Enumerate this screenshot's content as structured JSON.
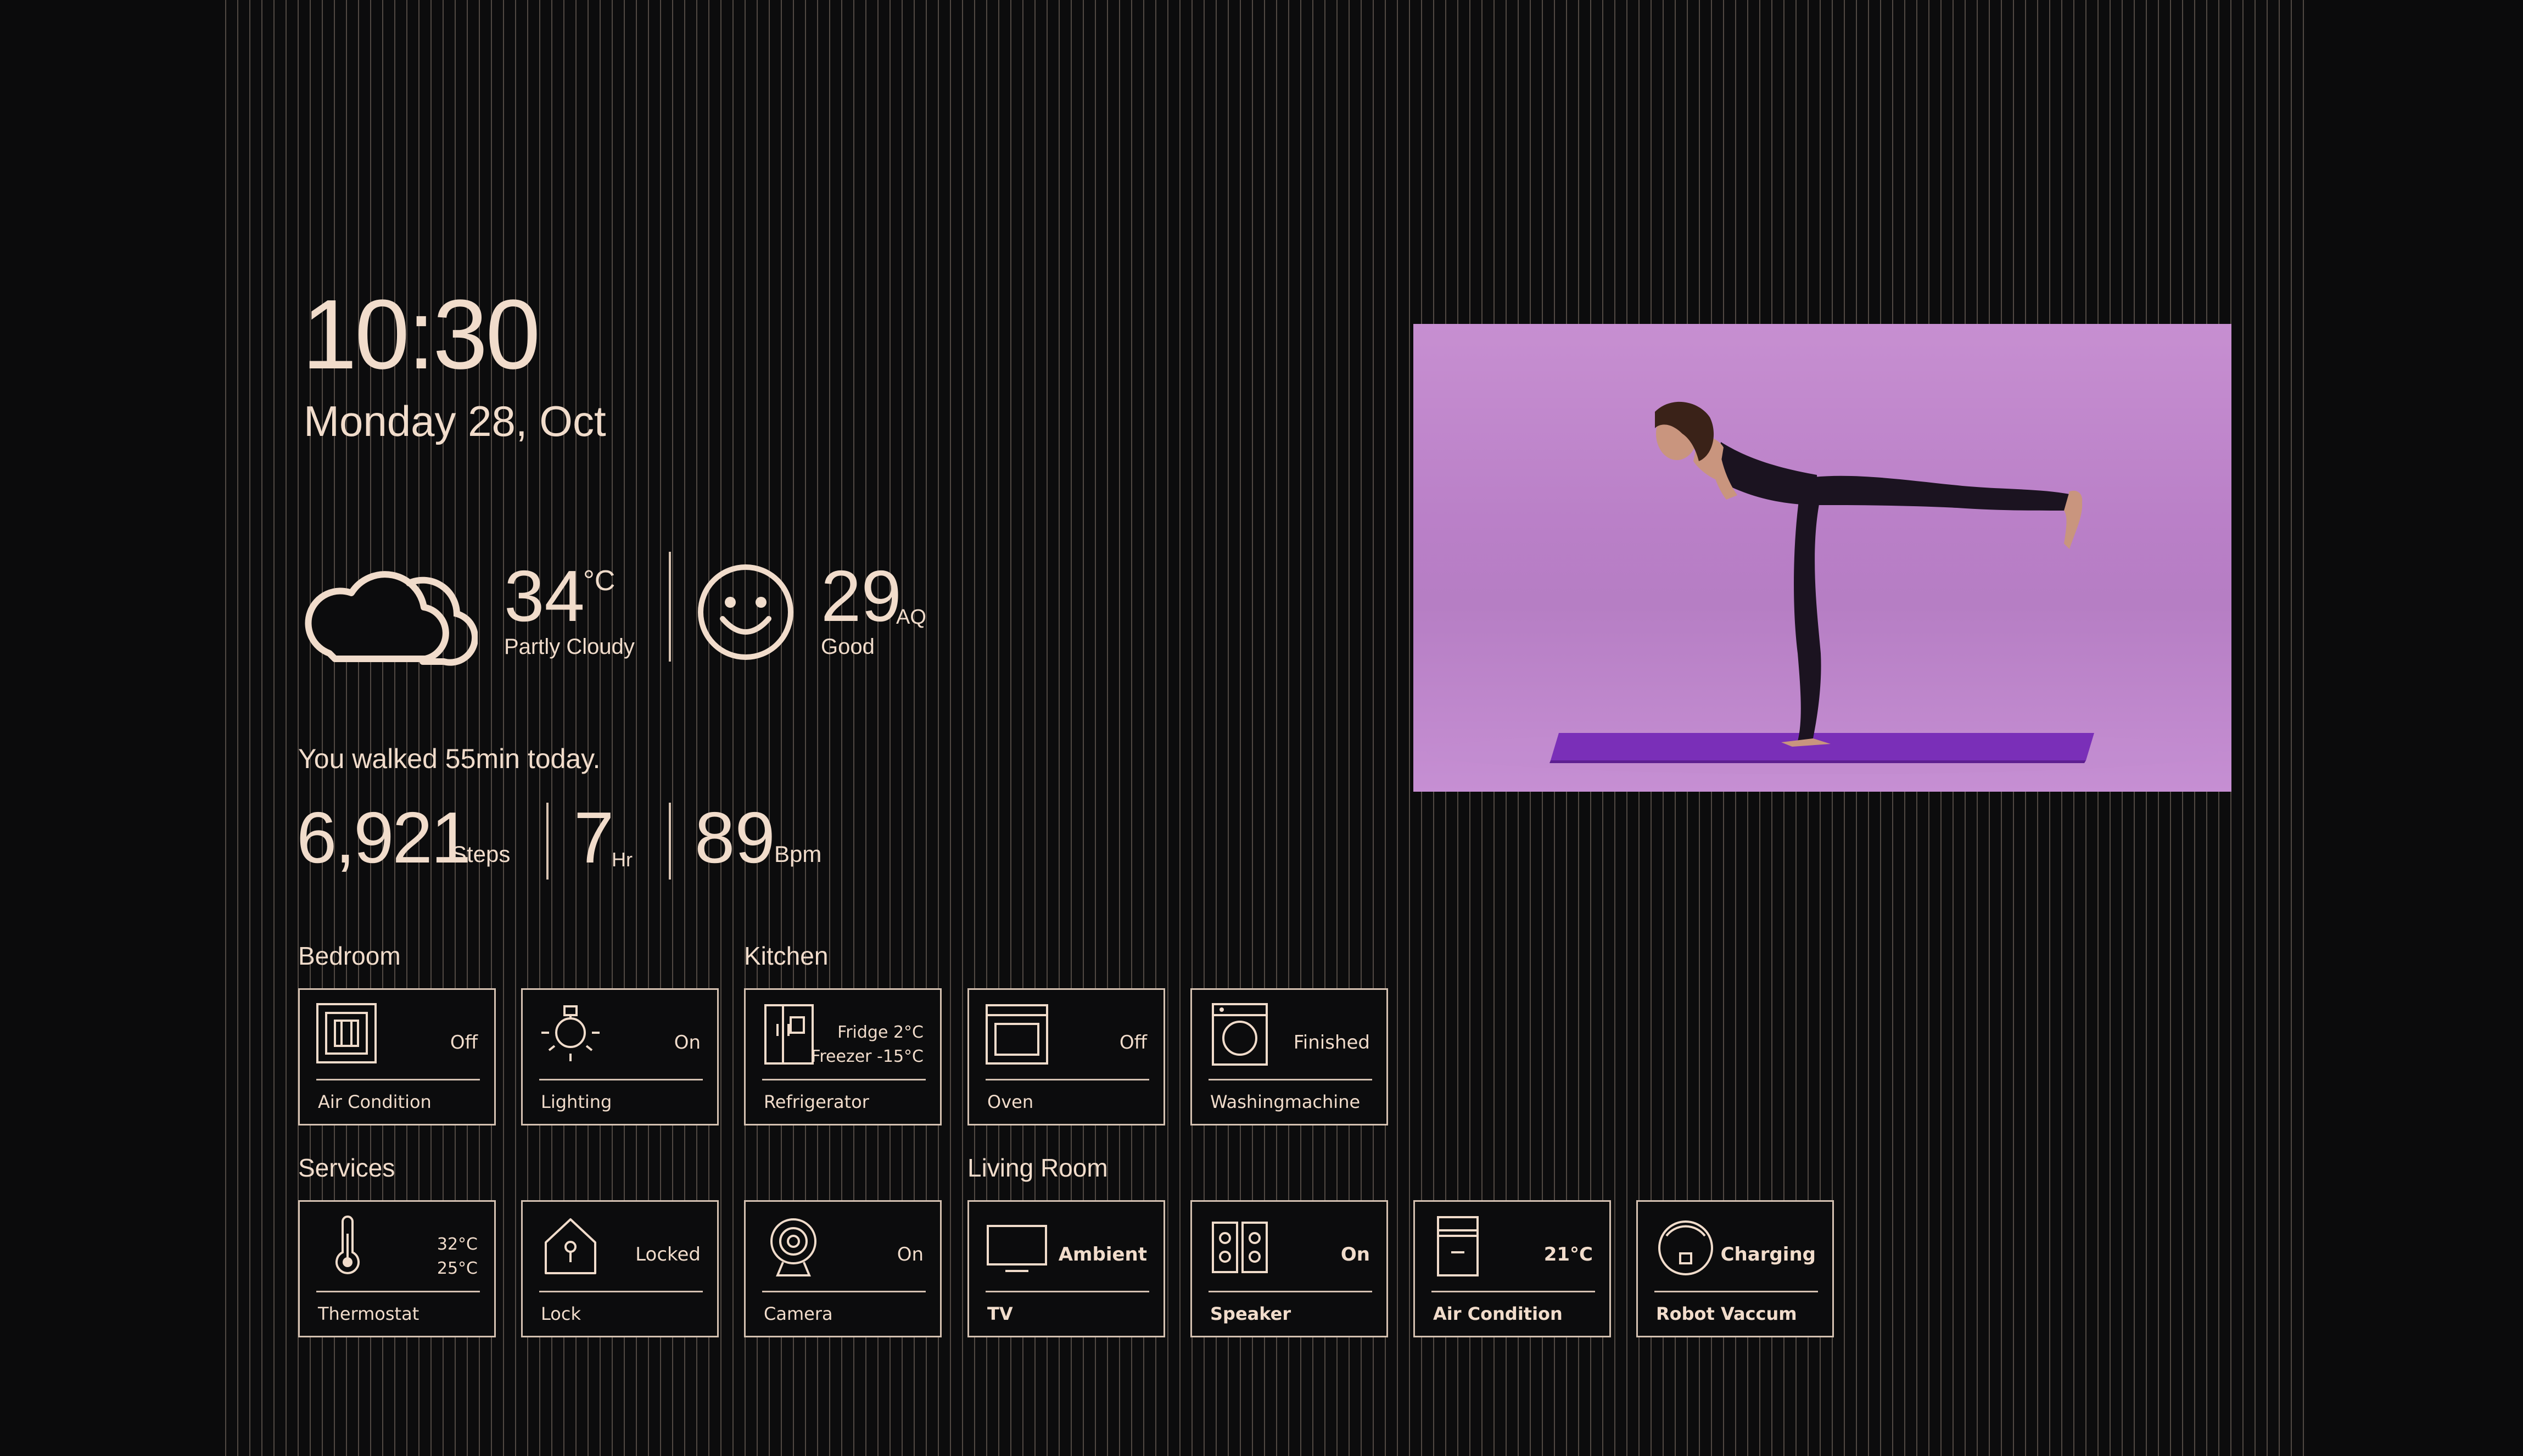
{
  "clock": {
    "time": "10:30",
    "date": "Monday 28, Oct"
  },
  "weather": {
    "icon": "cloud-icon",
    "temperature": "34",
    "unit": "°C",
    "condition": "Partly Cloudy"
  },
  "air_quality": {
    "icon": "smiley-icon",
    "value": "29",
    "unit": "AQ",
    "status": "Good"
  },
  "activity": {
    "summary": "You walked 55min today.",
    "steps": "6,921",
    "steps_unit": "Steps",
    "hours": "7",
    "hours_unit": "Hr",
    "bpm": "89",
    "bpm_unit": "Bpm"
  },
  "sections": {
    "bedroom": "Bedroom",
    "kitchen": "Kitchen",
    "services": "Services",
    "living_room": "Living Room"
  },
  "tiles": {
    "bedroom_ac": {
      "name": "Air Condition",
      "status": "Off",
      "icon": "air-conditioner-icon"
    },
    "lighting": {
      "name": "Lighting",
      "status": "On",
      "icon": "lightbulb-icon"
    },
    "refrigerator": {
      "name": "Refrigerator",
      "status_line1": "Fridge 2°C",
      "status_line2": "Freezer -15°C",
      "icon": "refrigerator-icon"
    },
    "oven": {
      "name": "Oven",
      "status": "Off",
      "icon": "oven-icon"
    },
    "washer": {
      "name": "Washingmachine",
      "status": "Finished",
      "icon": "washing-machine-icon"
    },
    "thermostat": {
      "name": "Thermostat",
      "status_line1": "32°C",
      "status_line2": "25°C",
      "icon": "thermometer-icon"
    },
    "lock": {
      "name": "Lock",
      "status": "Locked",
      "icon": "home-lock-icon"
    },
    "camera": {
      "name": "Camera",
      "status": "On",
      "icon": "camera-icon"
    },
    "tv": {
      "name": "TV",
      "status": "Ambient",
      "icon": "tv-icon"
    },
    "speaker": {
      "name": "Speaker",
      "status": "On",
      "icon": "speaker-icon"
    },
    "living_ac": {
      "name": "Air Condition",
      "status": "21°C",
      "icon": "air-conditioner-icon"
    },
    "robot_vacuum": {
      "name": "Robot Vaccum",
      "status": "Charging",
      "icon": "robot-vacuum-icon"
    }
  },
  "colors": {
    "accent": "#f1dccb",
    "background": "#0b0b0c",
    "photo_bg": "#c48cd0",
    "mat": "#7a2fb8"
  }
}
